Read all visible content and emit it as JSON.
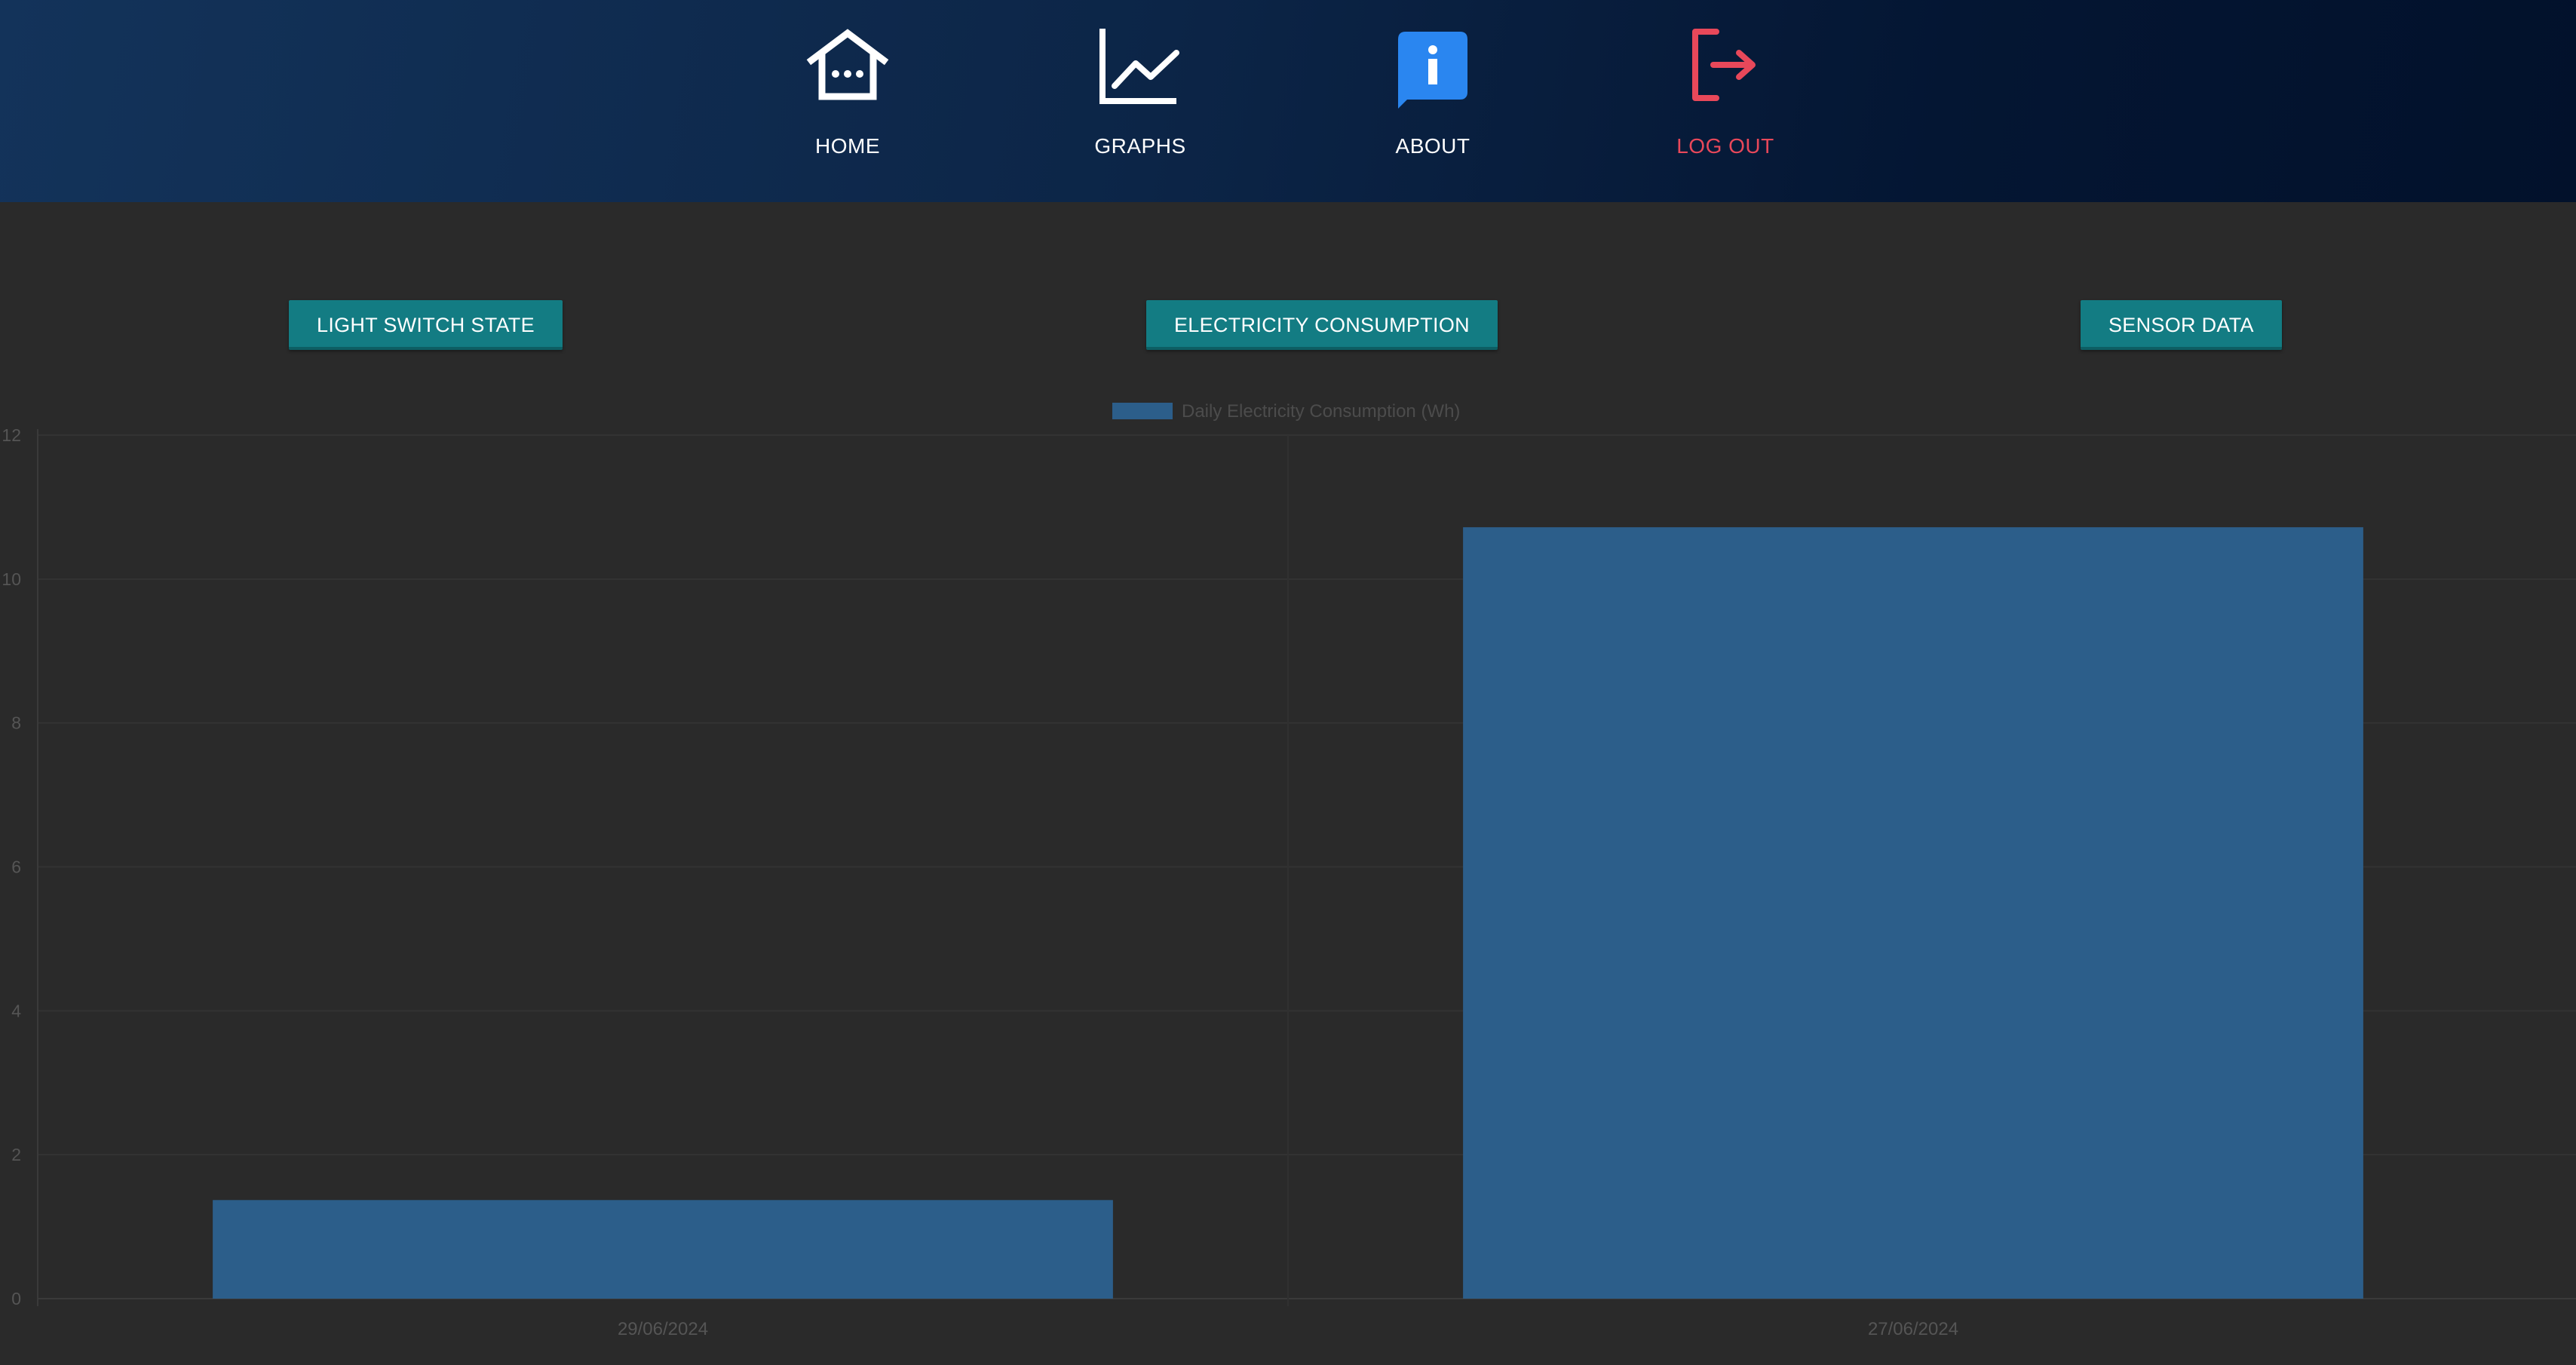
{
  "nav": {
    "home_label": "HOME",
    "graphs_label": "GRAPHS",
    "about_label": "ABOUT",
    "logout_label": "LOG OUT"
  },
  "buttons": {
    "light_switch": "LIGHT SWITCH STATE",
    "electricity": "ELECTRICITY CONSUMPTION",
    "sensor": "SENSOR DATA"
  },
  "colors": {
    "nav_text": "#ffffff",
    "logout": "#e8485a",
    "about_icon": "#2a86f0",
    "button_bg": "#137c83",
    "bar": "#2c5e8a",
    "page_bg": "#2a2a2a"
  },
  "chart_data": {
    "type": "bar",
    "categories": [
      "29/06/2024",
      "27/06/2024"
    ],
    "series": [
      {
        "name": "Daily Electricity Consumption (Wh)",
        "values": [
          1.37,
          10.72
        ]
      }
    ],
    "yticks": [
      "0",
      "2",
      "4",
      "6",
      "8",
      "10",
      "12"
    ],
    "ylim": [
      0,
      12
    ],
    "legend": "top-center",
    "grid": true
  }
}
